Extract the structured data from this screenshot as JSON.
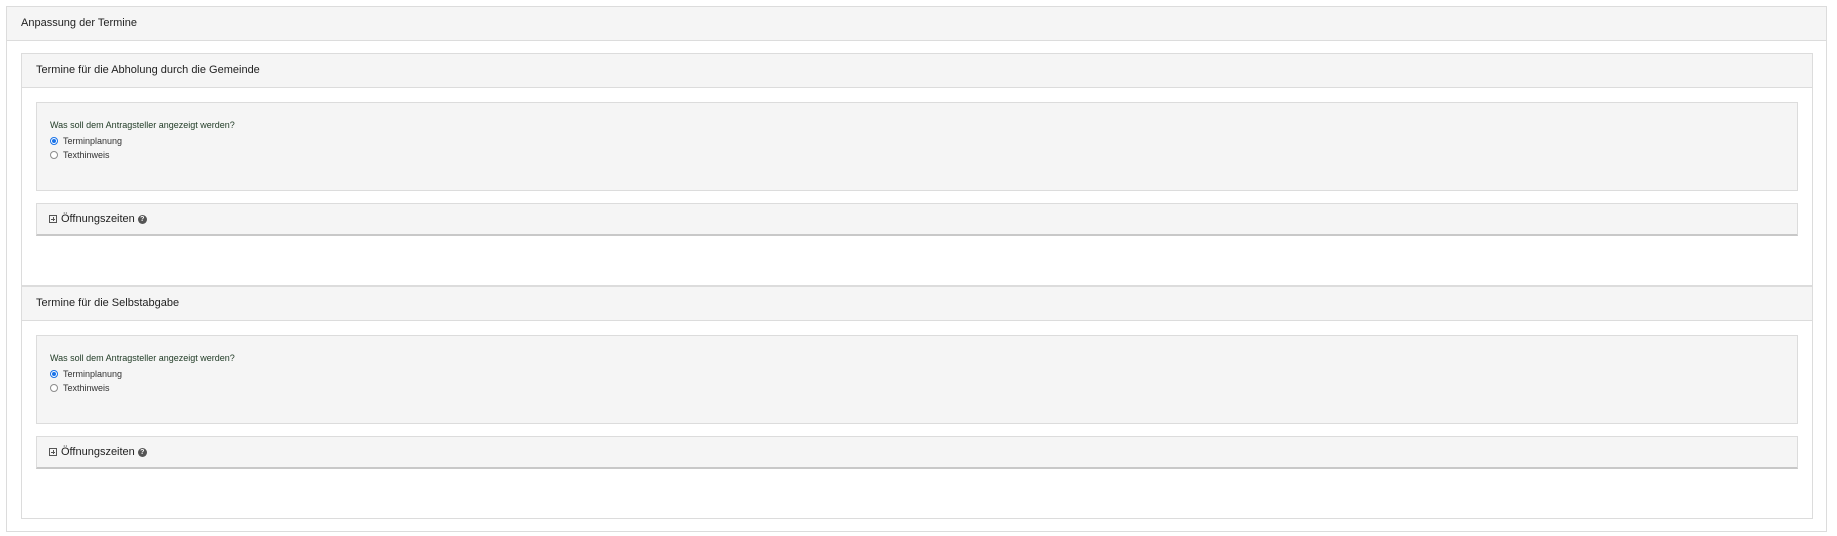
{
  "outer": {
    "title": "Anpassung der Termine"
  },
  "sections": [
    {
      "title": "Termine für die Abholung durch die Gemeinde",
      "question": "Was soll dem Antragsteller angezeigt werden?",
      "options": [
        "Terminplanung",
        "Texthinweis"
      ],
      "selected": "Terminplanung",
      "hours_label": "Öffnungszeiten"
    },
    {
      "title": "Termine für die Selbstabgabe",
      "question": "Was soll dem Antragsteller angezeigt werden?",
      "options": [
        "Terminplanung",
        "Texthinweis"
      ],
      "selected": "Terminplanung",
      "hours_label": "Öffnungszeiten"
    }
  ],
  "icons": {
    "expand": "plus-square-icon",
    "help": "question-circle-icon"
  },
  "colors": {
    "accent": "#1a73e8",
    "panel_bg": "#f5f5f5",
    "border": "#dcdcdc"
  }
}
